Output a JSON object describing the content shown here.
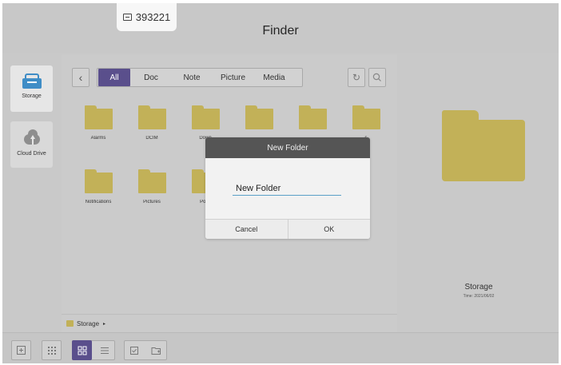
{
  "header": {
    "title": "Finder",
    "id_code": "393221"
  },
  "sidebar": {
    "items": [
      {
        "label": "Storage",
        "icon": "storage-icon",
        "active": true
      },
      {
        "label": "Cloud Drive",
        "icon": "cloud-upload-icon",
        "active": false
      }
    ]
  },
  "filters": {
    "tabs": [
      {
        "label": "All",
        "active": true
      },
      {
        "label": "Doc",
        "active": false
      },
      {
        "label": "Note",
        "active": false
      },
      {
        "label": "Picture",
        "active": false
      },
      {
        "label": "Media",
        "active": false
      }
    ]
  },
  "folders": [
    {
      "name": "Alarms"
    },
    {
      "name": "DCIM"
    },
    {
      "name": "Down"
    },
    {
      "name": ""
    },
    {
      "name": ""
    },
    {
      "name": "s"
    },
    {
      "name": "Notifications"
    },
    {
      "name": "Pictures"
    },
    {
      "name": "Podc"
    }
  ],
  "path": {
    "current": "Storage",
    "arrow": "▸"
  },
  "preview": {
    "name": "Storage",
    "time": "Time: 2021/06/02"
  },
  "dialog": {
    "title": "New Folder",
    "input_value": "New Folder",
    "cancel_label": "Cancel",
    "ok_label": "OK"
  },
  "colors": {
    "accent": "#5a4f8c",
    "folder": "#c2b158",
    "storage_icon": "#3f8dc6"
  }
}
